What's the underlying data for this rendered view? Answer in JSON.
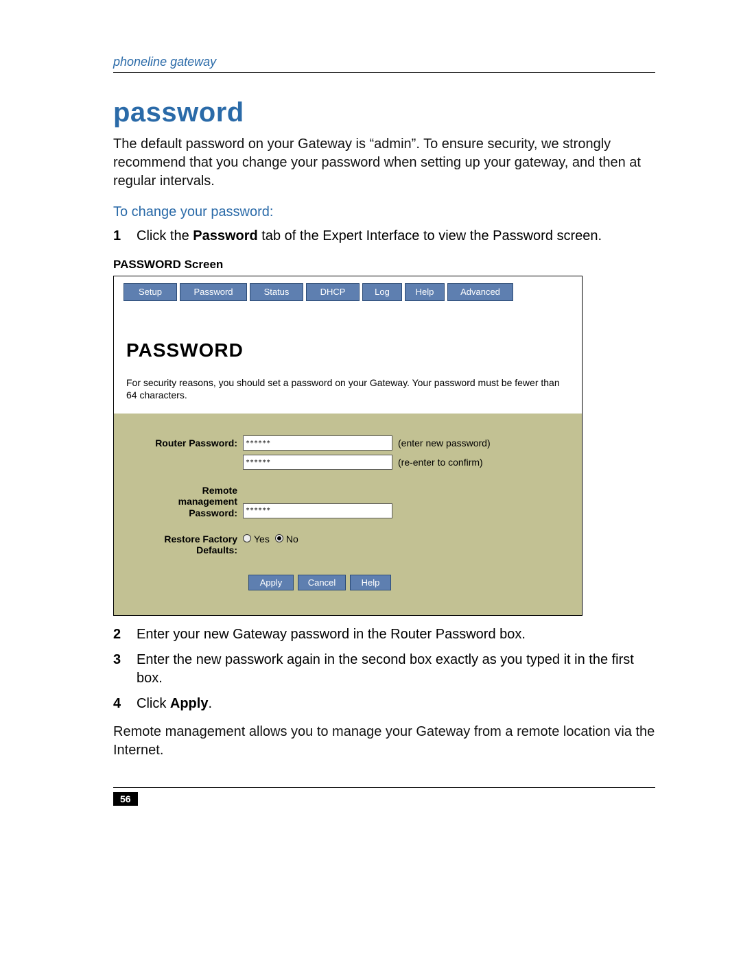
{
  "running_header": "phoneline gateway",
  "title": "password",
  "intro": "The default password on your Gateway is “admin”. To ensure security, we strongly recommend that you change your password when setting up your gateway, and then at regular intervals.",
  "subhead": "To change your password:",
  "step1_pre": "Click the ",
  "step1_bold": "Password",
  "step1_post": " tab of the Expert Interface to view the Password screen.",
  "caption": "PASSWORD Screen",
  "screenshot": {
    "tabs": {
      "setup": "Setup",
      "password": "Password",
      "status": "Status",
      "dhcp": "DHCP",
      "log": "Log",
      "help": "Help",
      "advanced": "Advanced"
    },
    "heading": "PASSWORD",
    "note": "For security reasons, you should set a password on your Gateway. Your password must be fewer than 64 characters.",
    "rows": {
      "router_password_label": "Router Password:",
      "router_password_value": "******",
      "hint_new": "(enter new password)",
      "confirm_value": "******",
      "hint_confirm": "(re-enter to confirm)",
      "remote_label_line1": "Remote",
      "remote_label_line2": "management",
      "remote_label_line3": "Password:",
      "remote_value": "******",
      "restore_label_line1": "Restore Factory",
      "restore_label_line2": "Defaults:",
      "restore_yes": "Yes",
      "restore_no": "No",
      "restore_selected": "No"
    },
    "buttons": {
      "apply": "Apply",
      "cancel": "Cancel",
      "help": "Help"
    }
  },
  "step2": "Enter your new Gateway password in the Router Password box.",
  "step3": "Enter the new passwork again in the second box exactly as you typed it in the first box.",
  "step4_pre": "Click ",
  "step4_bold": "Apply",
  "step4_post": ".",
  "outro": "Remote management allows you to manage your Gateway from a remote location via the Internet.",
  "page_number": "56"
}
